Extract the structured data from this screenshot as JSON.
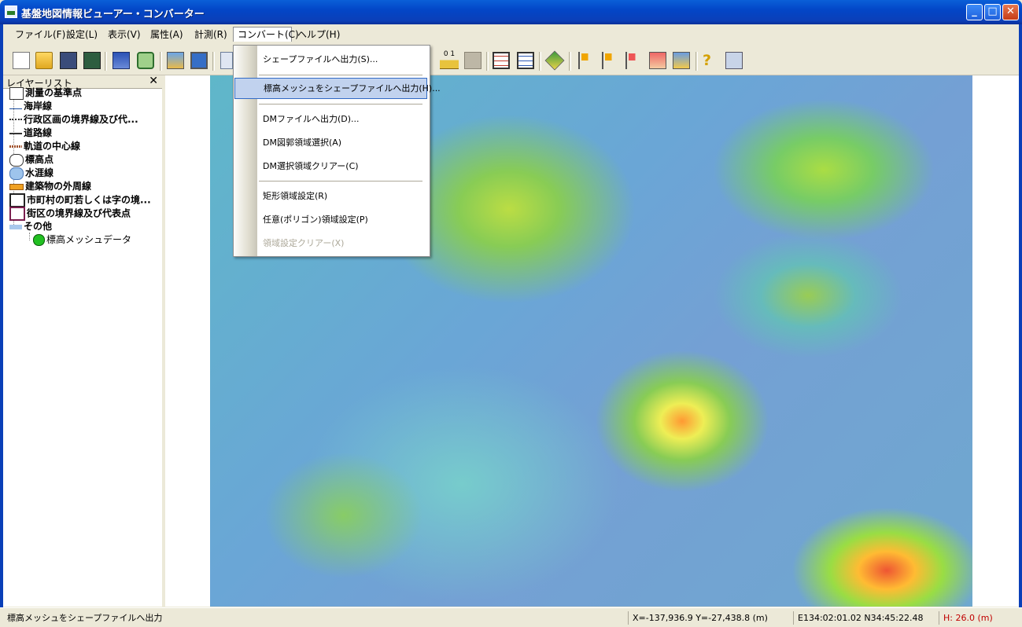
{
  "window": {
    "title": "基盤地図情報ビューアー・コンバーター",
    "minimize": "_",
    "maximize": "□",
    "close": "✕"
  },
  "menubar": [
    {
      "label": "ファイル(F)"
    },
    {
      "label": "設定(L)"
    },
    {
      "label": "表示(V)"
    },
    {
      "label": "属性(A)"
    },
    {
      "label": "計測(R)"
    },
    {
      "label": "コンバート(C)"
    },
    {
      "label": "ヘルプ(H)"
    }
  ],
  "toolbar": {
    "icons": [
      "new-icon",
      "open-folder-icon",
      "save-icon",
      "save-as-icon",
      "print-icon",
      "layer-icon",
      "export-icon",
      "monitor-icon",
      "window-icon",
      "ruler-icon",
      "image-icon",
      "list-icon",
      "table-icon",
      "flag-icon",
      "flag-icon",
      "flag-icon",
      "flag-icon",
      "area-icon",
      "chart-icon",
      "help-icon",
      "cursor-help-icon"
    ],
    "ruler_label": "0  1"
  },
  "layer_panel": {
    "title": "レイヤーリスト",
    "close": "✕",
    "items": [
      {
        "label": "測量の基準点"
      },
      {
        "label": "海岸線"
      },
      {
        "label": "行政区画の境界線及び代..."
      },
      {
        "label": "道路線"
      },
      {
        "label": "軌道の中心線"
      },
      {
        "label": "標高点"
      },
      {
        "label": "水涯線"
      },
      {
        "label": "建築物の外周線"
      },
      {
        "label": "市町村の町若しくは字の境..."
      },
      {
        "label": "街区の境界線及び代表点"
      },
      {
        "label": "その他"
      }
    ],
    "child": {
      "label": "標高メッシュデータ"
    }
  },
  "dropdown": {
    "items": [
      {
        "label": "シェープファイルへ出力(S)...",
        "state": "normal"
      },
      {
        "label": "標高メッシュをシェープファイルへ出力(H)...",
        "state": "highlighted"
      },
      {
        "label": "DMファイルへ出力(D)...",
        "state": "normal"
      },
      {
        "label": "DM図郭領域選択(A)",
        "state": "normal"
      },
      {
        "label": "DM選択領域クリアー(C)",
        "state": "normal"
      },
      {
        "label": "矩形領域設定(R)",
        "state": "normal"
      },
      {
        "label": "任意(ポリゴン)領域設定(P)",
        "state": "normal"
      },
      {
        "label": "領域設定クリアー(X)",
        "state": "disabled"
      }
    ]
  },
  "statusbar": {
    "message": "標高メッシュをシェープファイルへ出力",
    "xy": "X=-137,936.9 Y=-27,438.8 (m)",
    "lonlat": "E134:02:01.02 N34:45:22.48",
    "height": "H: 26.0 (m)",
    "height_color": "#c00000"
  }
}
